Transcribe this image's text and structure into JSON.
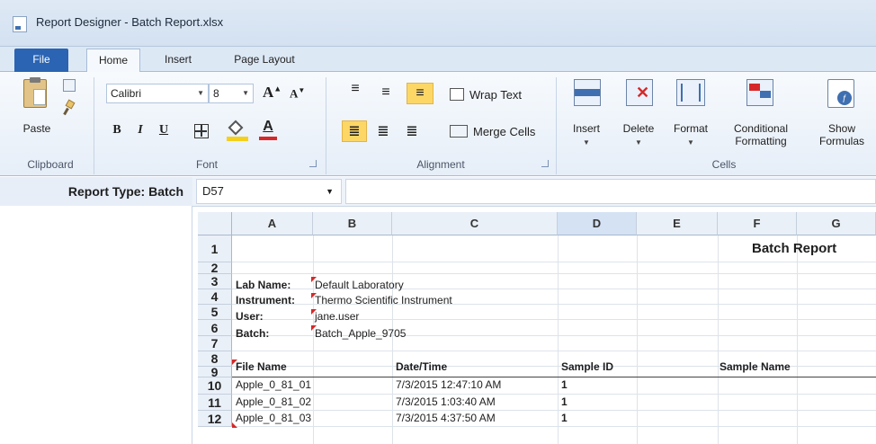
{
  "window": {
    "title": "Report Designer - Batch Report.xlsx"
  },
  "tabs": {
    "file": "File",
    "home": "Home",
    "insert": "Insert",
    "page_layout": "Page Layout"
  },
  "clipboard": {
    "paste": "Paste",
    "group": "Clipboard"
  },
  "font": {
    "name": "Calibri",
    "size": "8",
    "bold": "B",
    "italic": "I",
    "underline": "U",
    "group": "Font",
    "grow": "A",
    "shrink": "A",
    "color": "A"
  },
  "alignment": {
    "wrap": "Wrap Text",
    "merge": "Merge Cells",
    "group": "Alignment"
  },
  "cells": {
    "insert": "Insert",
    "delete": "Delete",
    "format": "Format",
    "conditional_1": "Conditional",
    "conditional_2": "Formatting",
    "show_1": "Show",
    "show_2": "Formulas",
    "group": "Cells"
  },
  "left_panel": {
    "report_type": "Report Type: Batch"
  },
  "formula_bar": {
    "name_box": "D57",
    "formula": ""
  },
  "sheet": {
    "columns": [
      "A",
      "B",
      "C",
      "D",
      "E",
      "F",
      "G"
    ],
    "selected_column": "D",
    "rows": [
      "1",
      "2",
      "3",
      "4",
      "5",
      "6",
      "7",
      "8",
      "9",
      "10",
      "11",
      "12"
    ],
    "report_title": "Batch Report",
    "lab_name_label": "Lab Name:",
    "lab_name": "Default Laboratory",
    "instrument_label": "Instrument:",
    "instrument": "Thermo Scientific Instrument",
    "user_label": "User:",
    "user": "jane.user",
    "batch_label": "Batch:",
    "batch": "Batch_Apple_9705",
    "headers": {
      "file_name": "File Name",
      "datetime": "Date/Time",
      "sample_id": "Sample ID",
      "sample_name": "Sample Name"
    },
    "data": [
      {
        "file": "Apple_0_81_01",
        "datetime": "7/3/2015 12:47:10 AM",
        "sample_id": "1"
      },
      {
        "file": "Apple_0_81_02",
        "datetime": "7/3/2015 1:03:40 AM",
        "sample_id": "1"
      },
      {
        "file": "Apple_0_81_03",
        "datetime": "7/3/2015 4:37:50 AM",
        "sample_id": "1"
      }
    ]
  },
  "colors": {
    "accent": "#2a64b3",
    "header_bg": "#eaf0f8",
    "selected_header": "#d4e2f4",
    "comment_marker": "#d62828"
  }
}
